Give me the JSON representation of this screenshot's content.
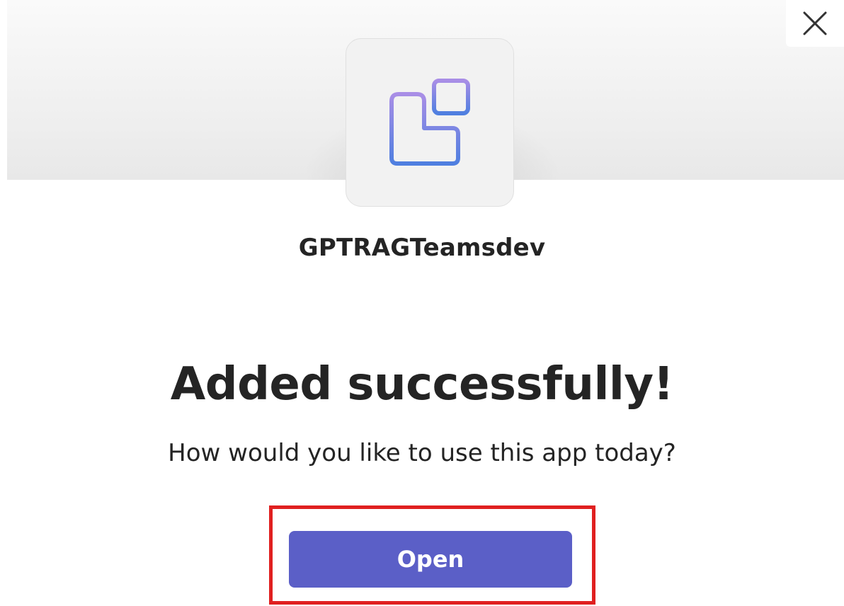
{
  "dialog": {
    "close_icon": "close-icon",
    "app_icon": "apps-grid-icon",
    "app_name": "GPTRAGTeamsdev",
    "headline": "Added successfully!",
    "subtext": "How would you like to use this app today?",
    "open_label": "Open"
  },
  "colors": {
    "primary_button": "#5b5fc7",
    "icon_gradient_top": "#a98ee6",
    "icon_gradient_bottom": "#4f7fe0",
    "highlight": "#e02020"
  }
}
